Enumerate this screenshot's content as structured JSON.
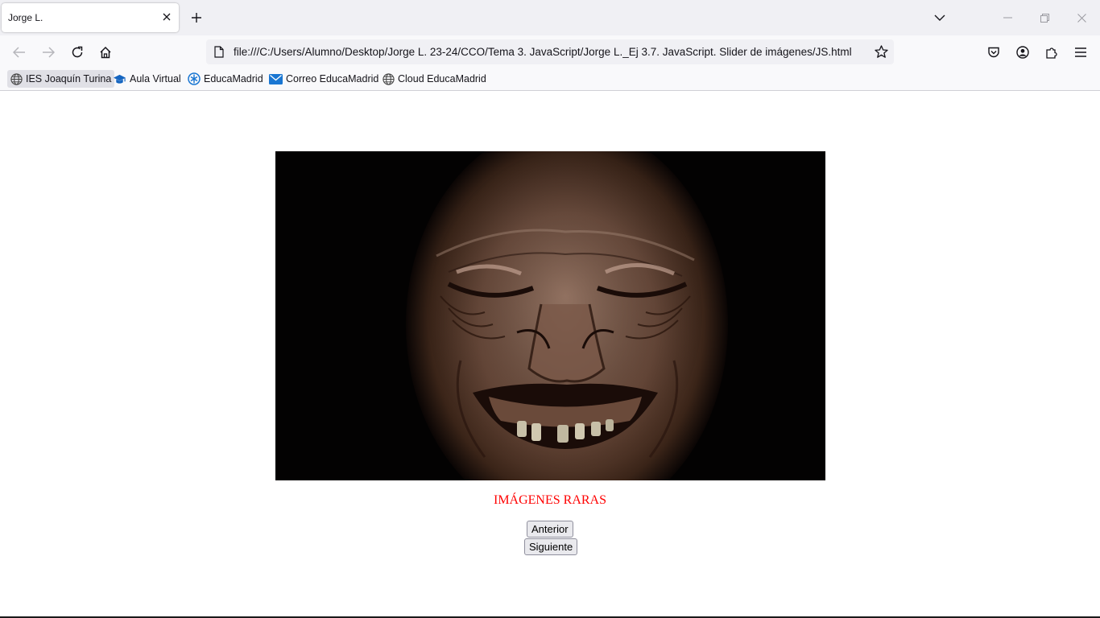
{
  "browser": {
    "tab_title": "Jorge L.",
    "url": "file:///C:/Users/Alumno/Desktop/Jorge L. 23-24/CCO/Tema 3. JavaScript/Jorge L._Ej 3.7. JavaScript. Slider de imágenes/JS.html",
    "bookmarks": [
      {
        "label": "IES Joaquín Turina",
        "icon": "globe-icon"
      },
      {
        "label": "Aula Virtual",
        "icon": "graduation-cap-icon"
      },
      {
        "label": "EducaMadrid",
        "icon": "educamadrid-logo-icon"
      },
      {
        "label": "Correo EducaMadrid",
        "icon": "mail-icon"
      },
      {
        "label": "Cloud EducaMadrid",
        "icon": "globe-icon"
      }
    ],
    "icons": {
      "tab_close": "close-icon",
      "new_tab": "plus-icon",
      "list_tabs": "chevron-down-icon",
      "back": "back-arrow-icon",
      "forward": "forward-arrow-icon",
      "reload": "reload-icon",
      "home": "home-icon",
      "page": "page-icon",
      "bookmark_star": "star-icon",
      "pocket": "pocket-icon",
      "account": "account-icon",
      "extensions": "extensions-icon",
      "menu": "hamburger-menu-icon",
      "minimize": "minimize-icon",
      "restore": "restore-icon",
      "close_window": "close-icon"
    }
  },
  "page": {
    "caption": "IMÁGENES RARAS",
    "caption_color": "#ff0000",
    "prev_label": "Anterior",
    "next_label": "Siguiente"
  }
}
